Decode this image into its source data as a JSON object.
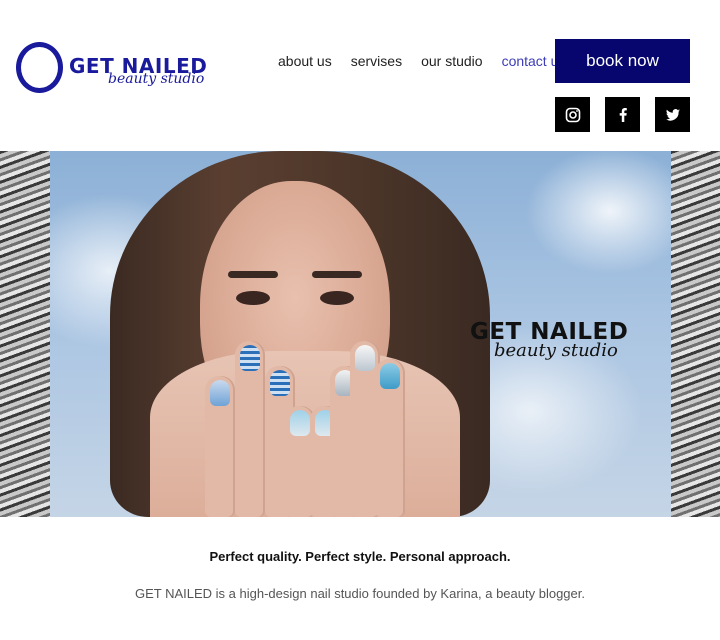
{
  "logo": {
    "title": "GET NAILED",
    "subtitle": "beauty studio",
    "color": "#1a1a9c"
  },
  "nav": {
    "items": [
      {
        "label": "about us",
        "active": false
      },
      {
        "label": "servises",
        "active": false
      },
      {
        "label": "our studio",
        "active": false
      },
      {
        "label": "contact us",
        "active": true
      }
    ],
    "active_color": "#3d3db8"
  },
  "book_button": {
    "label": "book now",
    "color": "#06066e"
  },
  "social": [
    {
      "icon": "instagram-icon"
    },
    {
      "icon": "facebook-icon"
    },
    {
      "icon": "twitter-icon"
    }
  ],
  "hero": {
    "brand_title": "GET NAILED",
    "brand_subtitle": "beauty studio"
  },
  "content": {
    "tagline": "Perfect quality. Perfect style. Personal approach.",
    "about": "GET NAILED is a high-design nail studio founded by Karina, a beauty blogger."
  }
}
